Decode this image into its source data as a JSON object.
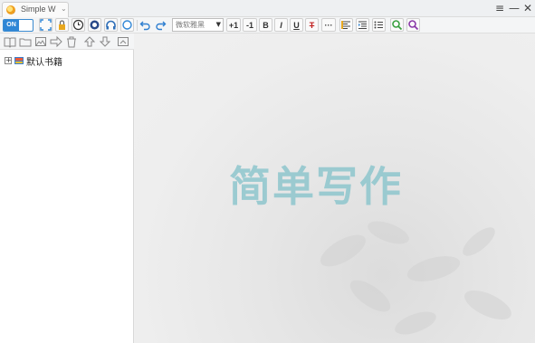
{
  "window": {
    "tab_title": "Simple W",
    "tab_dropdown_glyph": "⌄",
    "controls": {
      "menu_glyph": "≡",
      "minimize_glyph": "—",
      "close_glyph": "✕"
    }
  },
  "toolbar": {
    "toggle_label": "ON",
    "font_select_value": "微软雅黑",
    "font_increase_label": "+1",
    "font_decrease_label": "-1",
    "bold_label": "B",
    "italic_label": "I",
    "underline_label": "U",
    "strike_label": "T",
    "more_label": "···"
  },
  "tree": {
    "root_label": "默认书籍",
    "expander_glyph": "+"
  },
  "editor": {
    "watermark_text": "简单写作"
  },
  "colors": {
    "accent_blue": "#2f86d6",
    "watermark": "#8ec6cd",
    "search_icon": "#3aa040",
    "replace_icon": "#8a3aa8",
    "undo_redo": "#2f7fd0"
  }
}
